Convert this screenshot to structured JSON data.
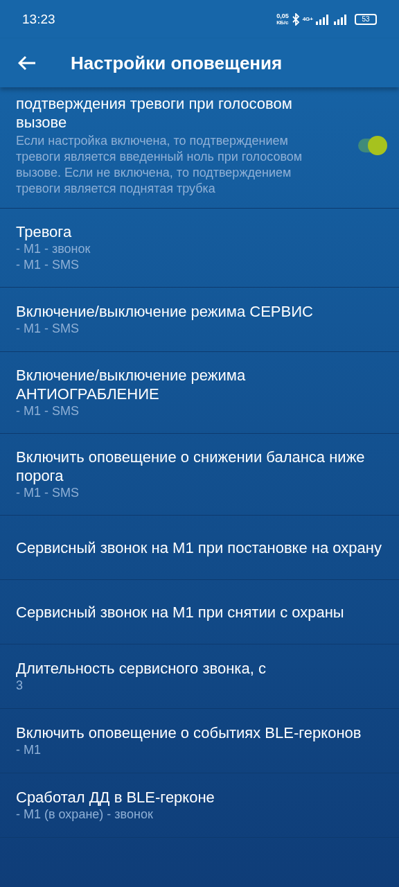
{
  "status_bar": {
    "time": "13:23",
    "speed_value": "0,05",
    "speed_unit": "КБ/с",
    "network": "4G+",
    "battery": "53"
  },
  "app_bar": {
    "title": "Настройки оповещения"
  },
  "settings": [
    {
      "kind": "switch",
      "title": "подтверждения тревоги при голосовом вызове",
      "summary": [
        "Если настройка включена, то подтверждением тревоги является введенный ноль при голосовом вызове. Если не включена, то подтверждением тревоги является поднятая трубка"
      ],
      "on": true
    },
    {
      "kind": "text",
      "title": "Тревога",
      "summary": [
        "- M1 - звонок",
        "- M1 - SMS"
      ]
    },
    {
      "kind": "text",
      "title": "Включение/выключение режима СЕРВИС",
      "summary": [
        "- M1 - SMS"
      ]
    },
    {
      "kind": "text",
      "title": "Включение/выключение режима АНТИОГРАБЛЕНИЕ",
      "summary": [
        "- M1 - SMS"
      ]
    },
    {
      "kind": "text",
      "title": "Включить оповещение о снижении баланса ниже порога",
      "summary": [
        "- M1 - SMS"
      ]
    },
    {
      "kind": "text",
      "title": "Сервисный звонок на M1 при постановке на охрану"
    },
    {
      "kind": "text",
      "title": "Сервисный звонок на M1 при снятии с охраны"
    },
    {
      "kind": "text",
      "title": "Длительность сервисного звонка, с",
      "summary": [
        "3"
      ]
    },
    {
      "kind": "text",
      "title": "Включить оповещение о событиях BLE-герконов",
      "summary": [
        "- M1"
      ]
    },
    {
      "kind": "text",
      "title": "Сработал ДД в BLE-герконе",
      "summary": [
        "- M1 (в охране) - звонок"
      ]
    }
  ]
}
